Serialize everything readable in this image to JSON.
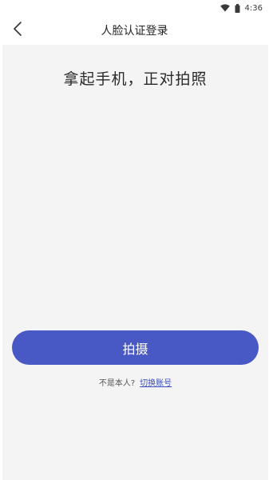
{
  "status_bar": {
    "time": "4:36",
    "icons": [
      "wifi-icon",
      "battery-icon"
    ]
  },
  "app_bar": {
    "back_icon": "chevron-left-icon",
    "title": "人脸认证登录"
  },
  "main": {
    "headline": "拿起手机，正对拍照",
    "capture_button": "拍摄",
    "not_me_text": "不是本人?",
    "switch_account_link": "切换账号"
  },
  "colors": {
    "accent": "#4858c4",
    "link": "#3d4fc0",
    "content_bg": "#f4f4f5"
  }
}
